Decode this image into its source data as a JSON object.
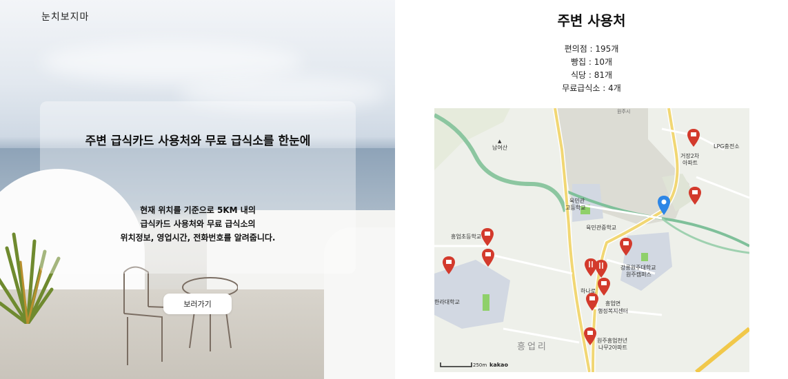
{
  "hero": {
    "logo": "눈치보지마",
    "title": "주변 급식카드 사용처와 무료 급식소를 한눈에",
    "description": [
      "현재 위치를 기준으로 5KM 내의",
      "급식카드 사용처와 무료 급식소의",
      "위치정보, 영업시간, 전화번호를 알려줍니다."
    ],
    "button_label": "보러가기"
  },
  "nearby": {
    "title": "주변 사용처",
    "stats": [
      "편의점 : 195개",
      "빵집 : 10개",
      "식당 : 81개",
      "무료급식소 : 4개"
    ]
  },
  "map": {
    "labels": {
      "nam_yeo_san": "남여산",
      "lpg": "LPG충전소",
      "apt_geojang": "거장2차",
      "apt_geojang2": "아파트",
      "yukmin_high1": "육민관",
      "yukmin_high2": "고등학교",
      "yukmin_middle": "육민관중학교",
      "heungeop_elem": "흥업초등학교",
      "gangneung_univ1": "강릉원주대학교",
      "gangneung_univ2": "원주캠퍼스",
      "halla_univ": "한라대학교",
      "hanaro": "하나로",
      "heungeop_office1": "흥업면",
      "heungeop_office2": "행정복지센터",
      "apt_wonju1": "원주흥업천년",
      "apt_wonju2": "나무2아파트",
      "area": "흥업리",
      "top_road": "원주시"
    },
    "scale": "250m",
    "provider": "kakao",
    "pin_color": "#d33a2c",
    "current_location_color": "#2d86e6"
  }
}
